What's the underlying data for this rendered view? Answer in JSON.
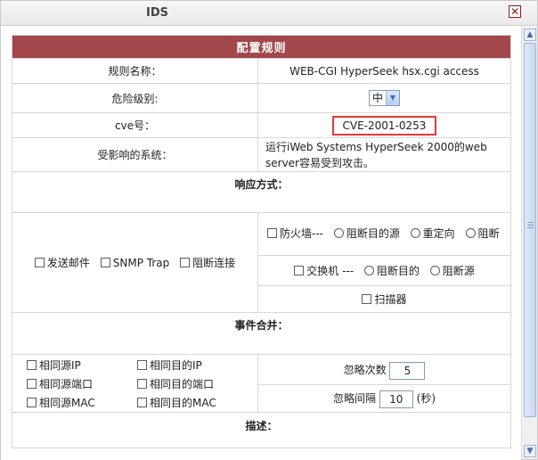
{
  "window": {
    "title": "IDS",
    "close_glyph": "✕"
  },
  "form": {
    "header": "配置规则",
    "rule_name": {
      "label": "规则名称：",
      "value": "WEB-CGI HyperSeek hsx.cgi access"
    },
    "danger_level": {
      "label": "危险级别:",
      "value": "中",
      "arrow": "▼"
    },
    "cve": {
      "label": "cve号：",
      "value": "CVE-2001-0253"
    },
    "affected_system": {
      "label": "受影响的系统：",
      "value": "运行iWeb Systems HyperSeek 2000的web server容易受到攻击。"
    },
    "response": {
      "title": "响应方式：",
      "send_email": "发送邮件",
      "snmp_trap": "SNMP Trap",
      "block_connection": "阻断连接",
      "firewall": {
        "label": "防火墙---",
        "options": [
          "阻断目的源",
          "重定向",
          "阻断"
        ]
      },
      "switch": {
        "label": "交换机 ---",
        "options": [
          "阻断目的",
          "阻断源"
        ]
      },
      "scanner": "扫描器"
    },
    "event_merge": {
      "title": "事件合并：",
      "checkboxes": [
        "相同源IP",
        "相同目的IP",
        "相同源端口",
        "相同目的端口",
        "相同源MAC",
        "相同目的MAC"
      ],
      "ignore_count": {
        "label": "忽略次数",
        "value": "5"
      },
      "ignore_interval": {
        "label": "忽略间隔",
        "value": "10",
        "unit": "(秒)"
      }
    },
    "description": {
      "title": "描述："
    }
  },
  "scrollbar": {
    "up": "▲",
    "down": "▼"
  },
  "colors": {
    "header_bg": "#a3474b",
    "cve_highlight": "#e23a3a"
  }
}
